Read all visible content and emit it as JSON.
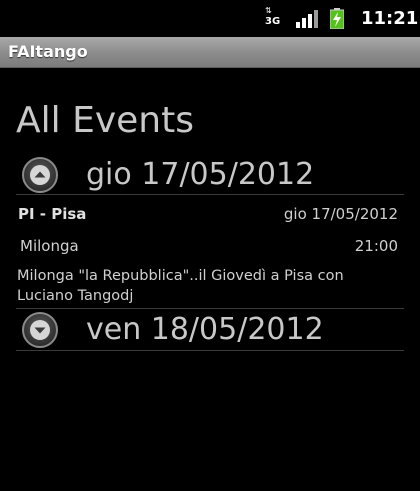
{
  "status_bar": {
    "network_label": "3G",
    "network_icon": "data-3g-arrows-icon",
    "signal_icon": "signal-bars-icon",
    "battery_icon": "battery-charging-icon",
    "time": "11:21"
  },
  "app": {
    "title": "FAItango"
  },
  "page": {
    "title": "All Events"
  },
  "days": [
    {
      "label": "gio 17/05/2012",
      "expanded": true,
      "icon": "collapse-arrow-up-icon",
      "events": [
        {
          "location": "PI - Pisa",
          "date": "gio 17/05/2012",
          "type": "Milonga",
          "time": "21:00",
          "description_line1": "Milonga \"la Repubblica\"..il Giovedì a Pisa con",
          "description_line2": "Luciano Tangodj"
        }
      ]
    },
    {
      "label": "ven 18/05/2012",
      "expanded": false,
      "icon": "expand-arrow-down-icon",
      "events": []
    }
  ],
  "colors": {
    "background": "#000000",
    "title_bar": "#8b8b8b",
    "battery_green": "#55c21b",
    "text": "#c8c8c8"
  }
}
